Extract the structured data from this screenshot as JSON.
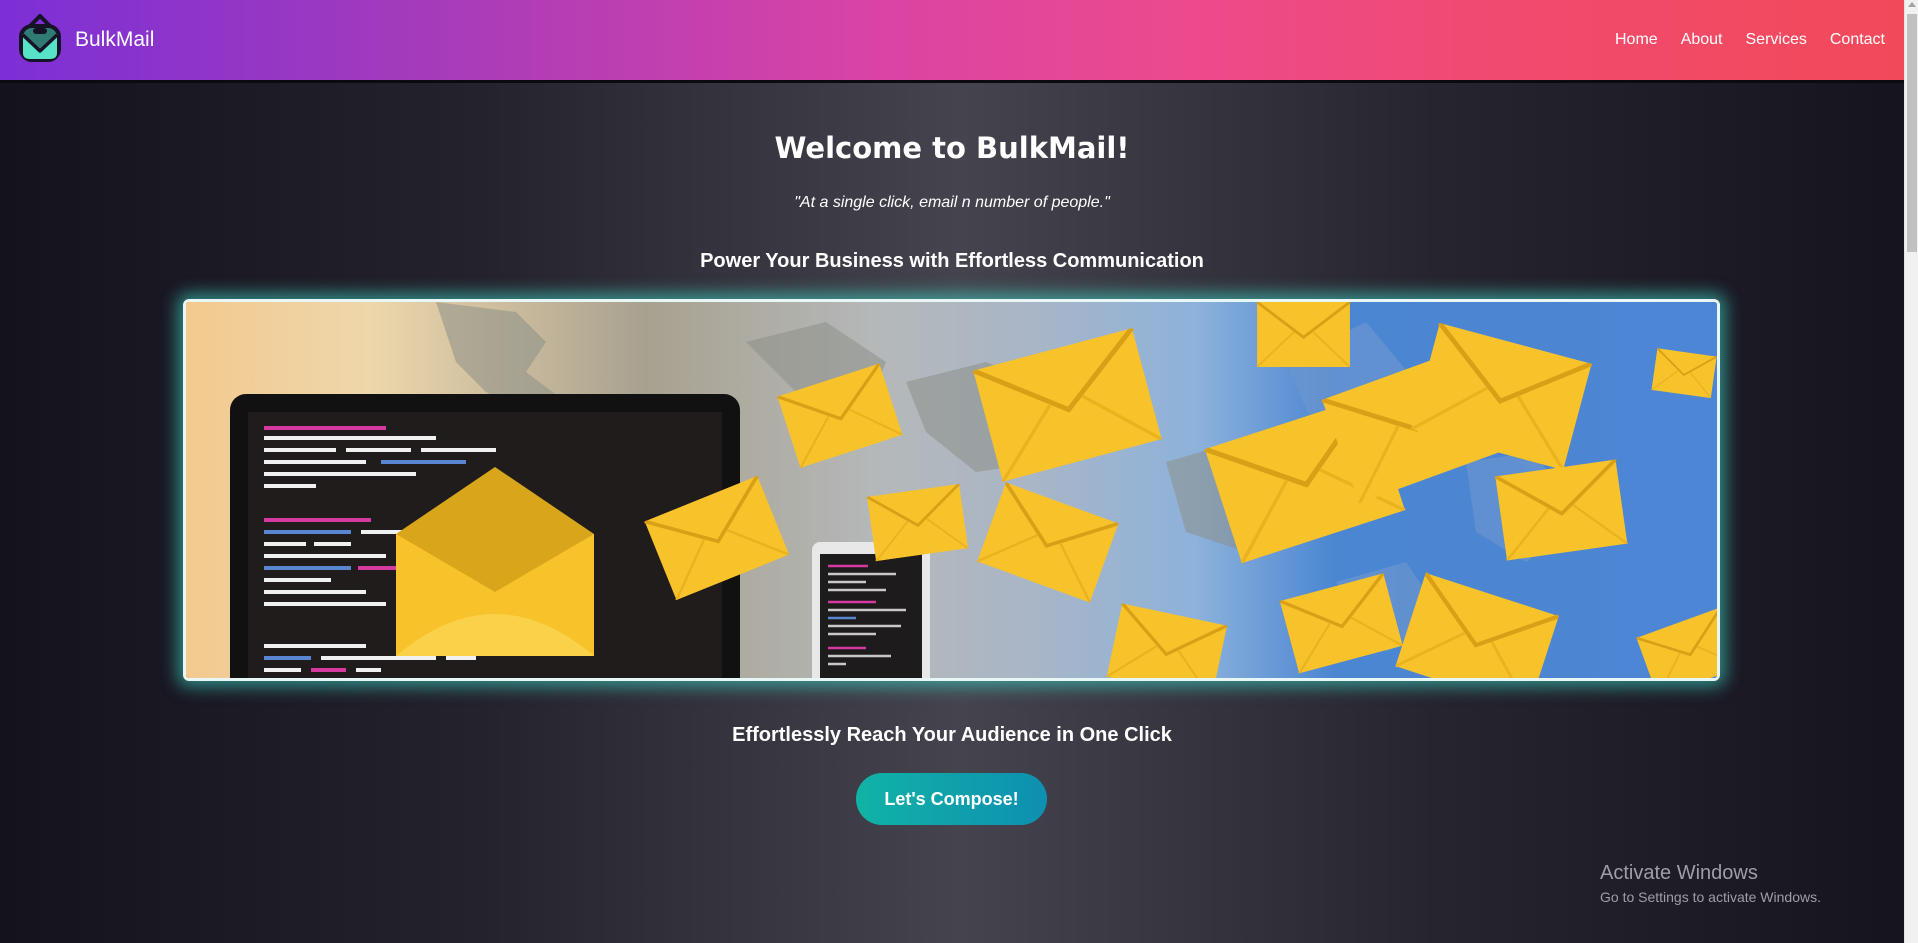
{
  "colors": {
    "nav_gradient": [
      "#7c2fd6",
      "#d843a6",
      "#f2495a"
    ],
    "button_gradient": [
      "#11b3a6",
      "#0e8fb0"
    ],
    "hero_glow": "#40e0d0",
    "envelope": "#f8c22a"
  },
  "navbar": {
    "logo_icon": "envelope-logo-icon",
    "brand": "BulkMail",
    "links": [
      {
        "label": "Home"
      },
      {
        "label": "About"
      },
      {
        "label": "Services"
      },
      {
        "label": "Contact"
      }
    ]
  },
  "main": {
    "title": "Welcome to BulkMail!",
    "tagline": "\"At a single click, email n number of people.\"",
    "subtitle": "Power Your Business with Effortless Communication",
    "hero_image": "laptop-sending-envelopes-over-world-map-illustration",
    "reach_text": "Effortlessly Reach Your Audience in One Click",
    "cta_label": "Let's Compose!"
  },
  "os_overlay": {
    "title": "Activate Windows",
    "subtitle": "Go to Settings to activate Windows."
  }
}
